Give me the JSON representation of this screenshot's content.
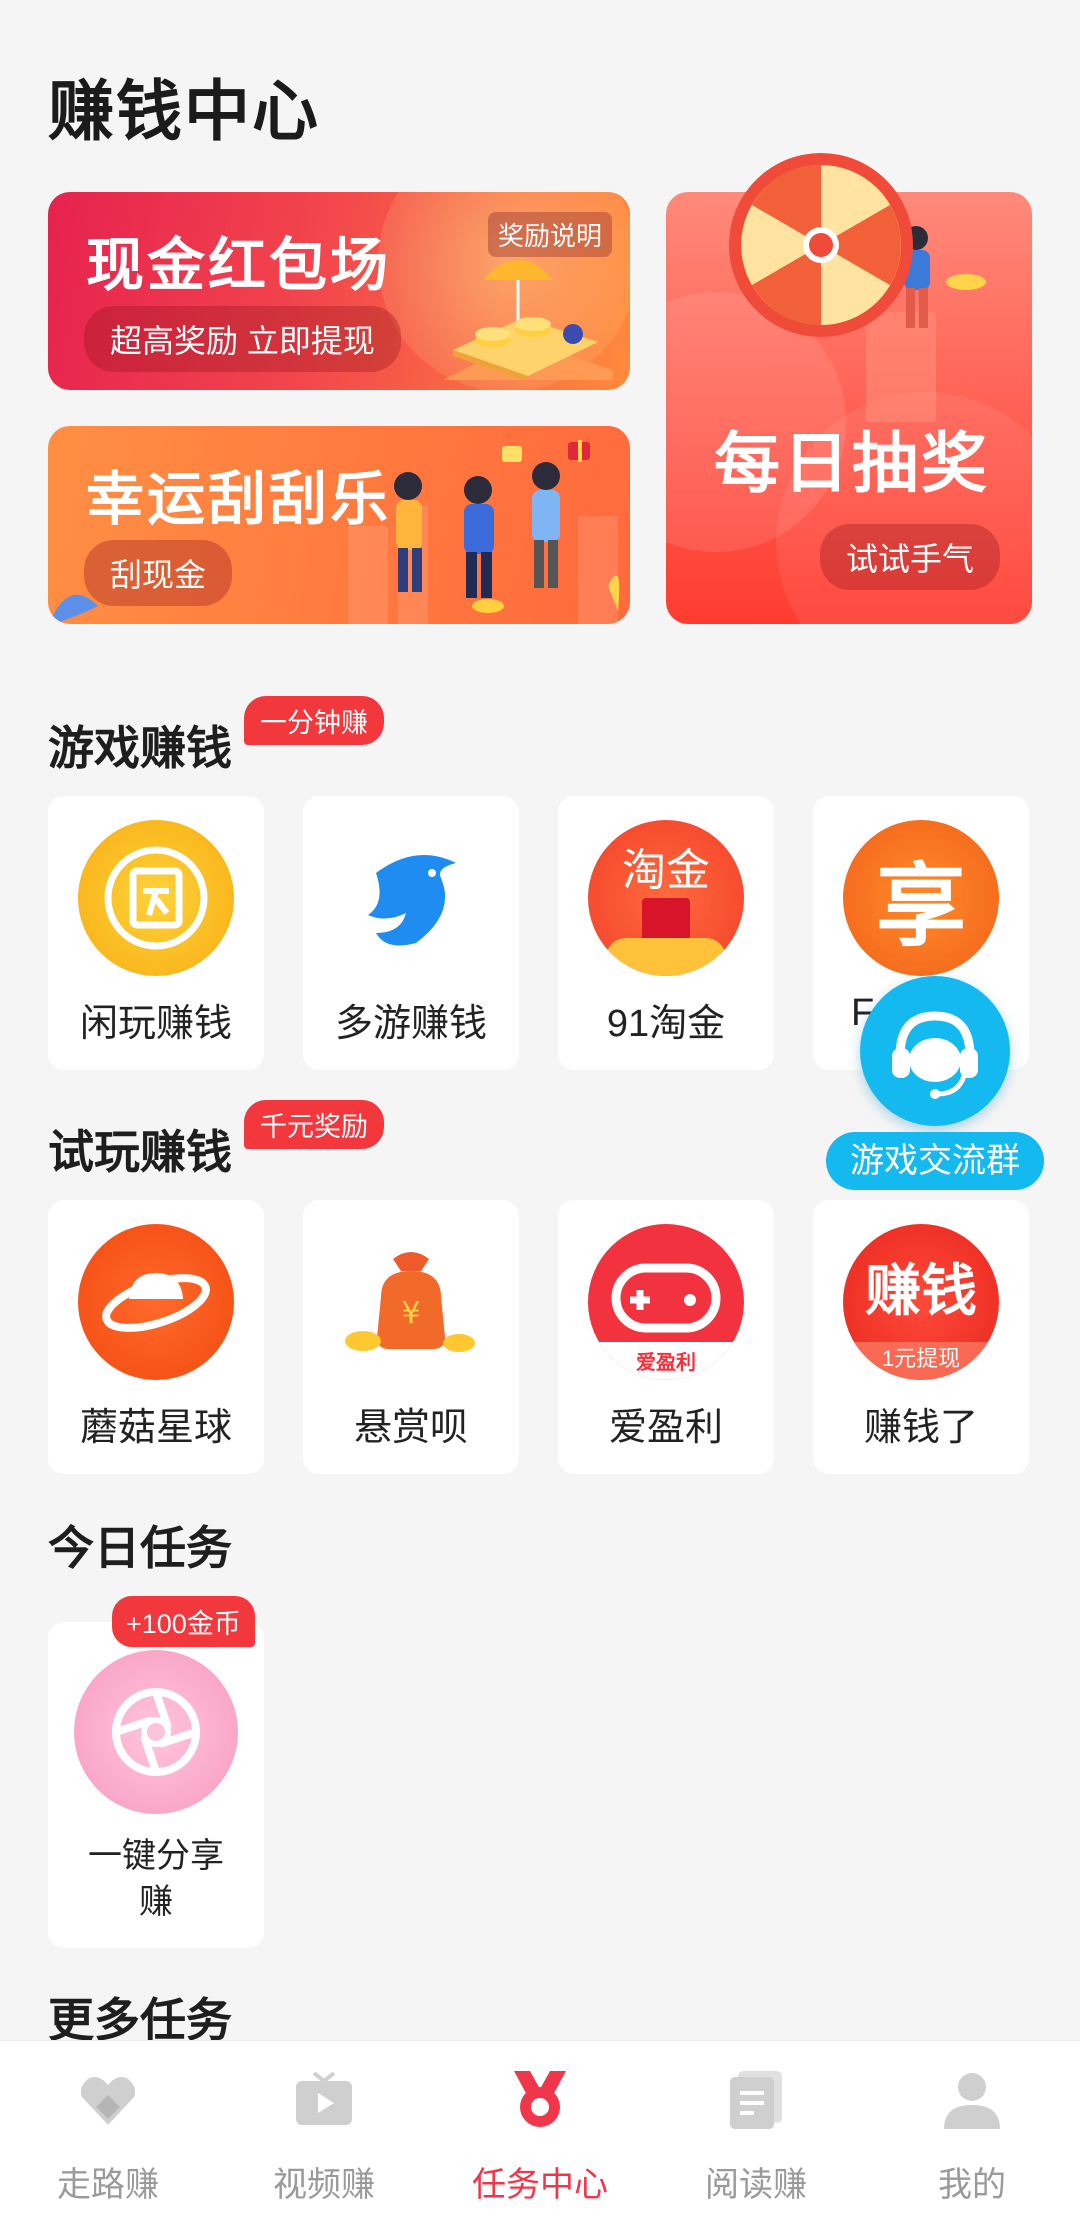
{
  "page_title": "赚钱中心",
  "promo": {
    "cash": {
      "title": "现金红包场",
      "note": "奖励说明",
      "button": "超高奖励 立即提现"
    },
    "scratch": {
      "title": "幸运刮刮乐",
      "button": "刮现金"
    },
    "lottery": {
      "title": "每日抽奖",
      "button": "试试手气"
    }
  },
  "games": {
    "title": "游戏赚钱",
    "badge": "一分钟赚",
    "items": [
      {
        "label": "闲玩赚钱",
        "icon": "xianwan-icon"
      },
      {
        "label": "多游赚钱",
        "icon": "dolphin-icon"
      },
      {
        "label": "91淘金",
        "icon": "taojin-icon",
        "icon_text": "淘金"
      },
      {
        "label": "F",
        "icon": "xiang-icon",
        "icon_text": "享"
      }
    ]
  },
  "float_button": {
    "label": "游戏交流群",
    "icon": "customer-service-icon"
  },
  "trial": {
    "title": "试玩赚钱",
    "badge": "千元奖励",
    "items": [
      {
        "label": "蘑菇星球",
        "icon": "planet-icon"
      },
      {
        "label": "悬赏呗",
        "icon": "money-bag-icon"
      },
      {
        "label": "爱盈利",
        "icon": "gamepad-icon",
        "icon_text": "爱盈利"
      },
      {
        "label": "赚钱了",
        "icon": "zhuanqian-icon",
        "icon_text": "赚钱",
        "icon_sub": "1元提现"
      }
    ]
  },
  "today": {
    "title": "今日任务",
    "items": [
      {
        "label_line1": "一键分享",
        "label_line2": "赚",
        "badge": "+100金币",
        "icon": "share-shutter-icon"
      }
    ]
  },
  "more": {
    "title": "更多任务"
  },
  "nav": {
    "items": [
      {
        "label": "走路赚",
        "icon": "walk-icon"
      },
      {
        "label": "视频赚",
        "icon": "video-icon"
      },
      {
        "label": "任务中心",
        "icon": "medal-icon",
        "active": true
      },
      {
        "label": "阅读赚",
        "icon": "read-icon"
      },
      {
        "label": "我的",
        "icon": "user-icon"
      }
    ]
  },
  "colors": {
    "accent": "#f0364a",
    "badge": "#f2373d",
    "float": "#14b9f0"
  }
}
